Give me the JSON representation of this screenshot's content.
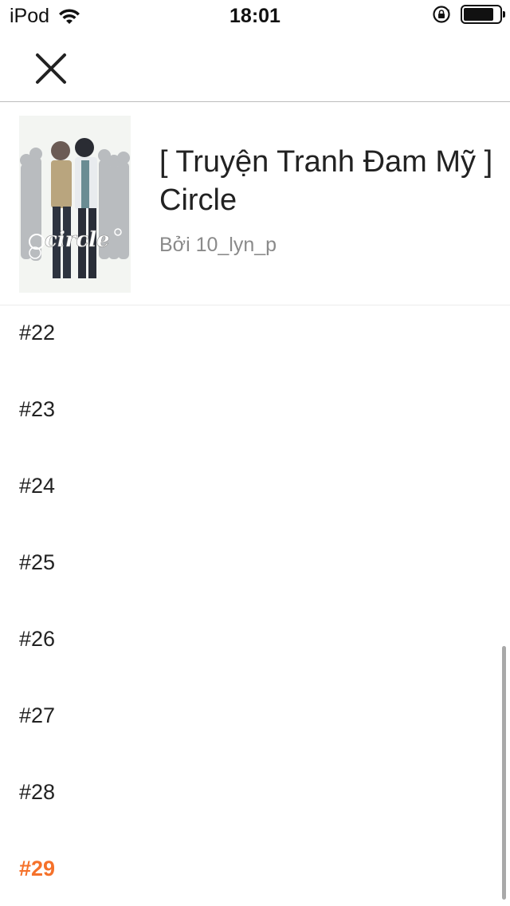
{
  "status_bar": {
    "carrier": "iPod",
    "time": "18:01",
    "battery_level": 0.85
  },
  "nav": {
    "close_icon": "close-icon"
  },
  "story": {
    "title": "[ Truyện Tranh Đam Mỹ ] Circle",
    "author": "Bởi 10_lyn_p",
    "cover_text": "circle"
  },
  "chapters": [
    {
      "label": "#22",
      "active": false
    },
    {
      "label": "#23",
      "active": false
    },
    {
      "label": "#24",
      "active": false
    },
    {
      "label": "#25",
      "active": false
    },
    {
      "label": "#26",
      "active": false
    },
    {
      "label": "#27",
      "active": false
    },
    {
      "label": "#28",
      "active": false
    },
    {
      "label": "#29",
      "active": true
    }
  ],
  "colors": {
    "accent": "#f5712a",
    "text": "#222222",
    "muted": "#8a8a8a"
  }
}
